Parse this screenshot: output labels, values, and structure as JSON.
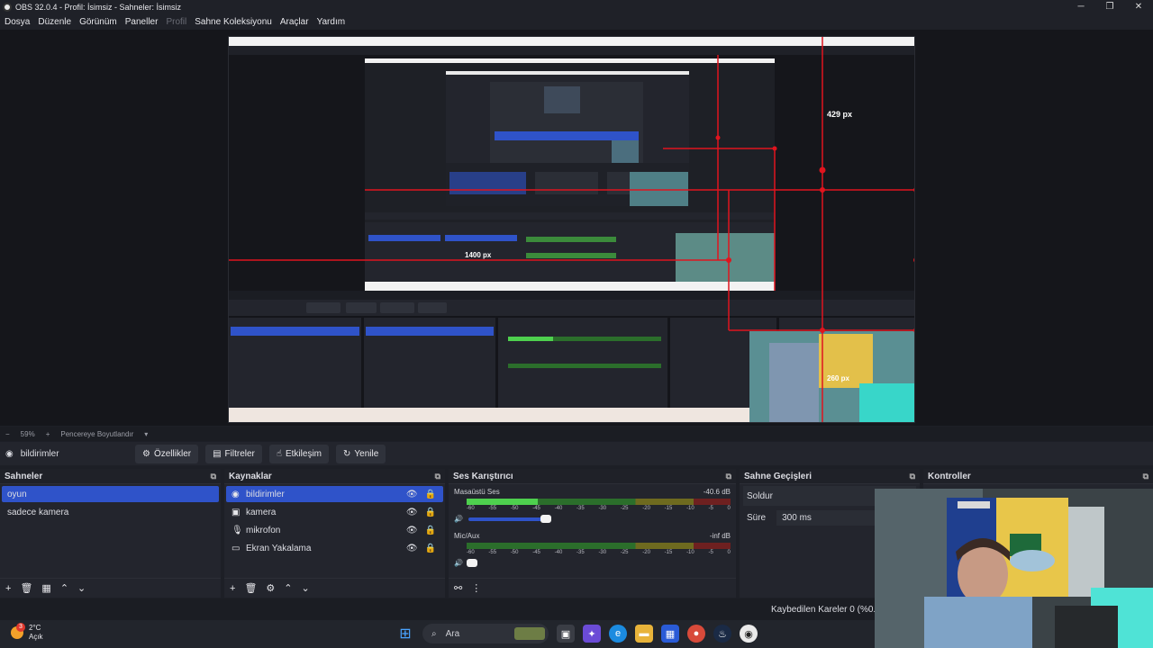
{
  "window": {
    "title": "OBS 32.0.4 - Profil: İsimsiz - Sahneler: İsimsiz",
    "controls": [
      "─",
      "❐",
      "✕"
    ]
  },
  "menu": {
    "items": [
      "Dosya",
      "Düzenle",
      "Görünüm",
      "Paneller",
      "Profil",
      "Sahne Koleksiyonu",
      "Araçlar",
      "Yardım"
    ]
  },
  "preview": {
    "labels": {
      "a": "429 px",
      "b": "1400 px",
      "c": "260 px"
    }
  },
  "zoom": {
    "level": "59%",
    "mode": "Pencereye Boyutlandır"
  },
  "source_toolbar": {
    "selected_source": "bildirimler",
    "properties_label": "Özellikler",
    "filters_label": "Filtreler",
    "interact_label": "Etkileşim",
    "refresh_label": "Yenile"
  },
  "scenes": {
    "title": "Sahneler",
    "items": [
      {
        "label": "oyun",
        "selected": true
      },
      {
        "label": "sadece kamera",
        "selected": false
      }
    ]
  },
  "sources": {
    "title": "Kaynaklar",
    "items": [
      {
        "label": "bildirimler",
        "icon": "globe-icon",
        "selected": true
      },
      {
        "label": "kamera",
        "icon": "camera-icon",
        "selected": false
      },
      {
        "label": "mikrofon",
        "icon": "microphone-icon",
        "selected": false
      },
      {
        "label": "Ekran Yakalama",
        "icon": "monitor-icon",
        "selected": false
      }
    ]
  },
  "mixer": {
    "title": "Ses Karıştırıcı",
    "tracks": [
      {
        "name": "Masaüstü Ses",
        "db": "-40.6 dB",
        "level": 0.27
      },
      {
        "name": "Mic/Aux",
        "db": "-inf dB",
        "level": 0.0
      }
    ],
    "scale": [
      "-60",
      "-55",
      "-50",
      "-45",
      "-40",
      "-35",
      "-30",
      "-25",
      "-20",
      "-15",
      "-10",
      "-5",
      "0"
    ]
  },
  "transitions": {
    "title": "Sahne Geçişleri",
    "selected": "Soldur",
    "duration_label": "Süre",
    "duration_value": "300 ms"
  },
  "controls": {
    "title": "Kontroller"
  },
  "status": {
    "dropped_frames": "Kaybedilen Kareler 0 (%0.0)"
  },
  "taskbar": {
    "temperature": "2°C",
    "weather": "Açık",
    "badge": "3",
    "search_placeholder": "Ara"
  },
  "colors": {
    "accent": "#2f53c9",
    "guide": "#e0141e"
  }
}
